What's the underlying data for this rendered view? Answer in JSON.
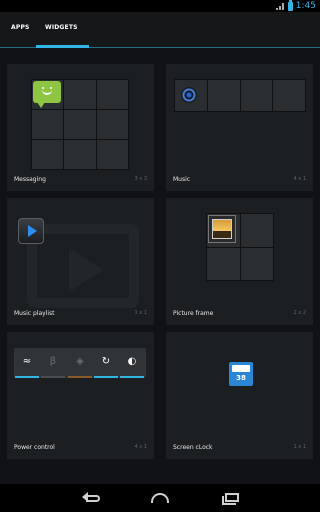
{
  "status_bar": {
    "time": "1:45",
    "signal_label": "3G"
  },
  "tabs": [
    {
      "label": "APPS",
      "selected": false
    },
    {
      "label": "WIDGETS",
      "selected": true
    }
  ],
  "widgets": [
    {
      "name": "Messaging",
      "size": "3 x 3"
    },
    {
      "name": "Music",
      "size": "4 x 1"
    },
    {
      "name": "Music playlist",
      "size": "1 x 1"
    },
    {
      "name": "Picture frame",
      "size": "2 x 2"
    },
    {
      "name": "Power control",
      "size": "4 x 1"
    },
    {
      "name": "Screen cLock",
      "size": "1 x 1"
    }
  ],
  "screen_clock_badge": "38",
  "accent_color": "#33b5e5",
  "icons": {
    "power_control": [
      "wifi-icon",
      "bluetooth-icon",
      "gps-icon",
      "sync-icon",
      "brightness-icon"
    ],
    "nav": [
      "back-icon",
      "home-icon",
      "recent-apps-icon"
    ]
  }
}
